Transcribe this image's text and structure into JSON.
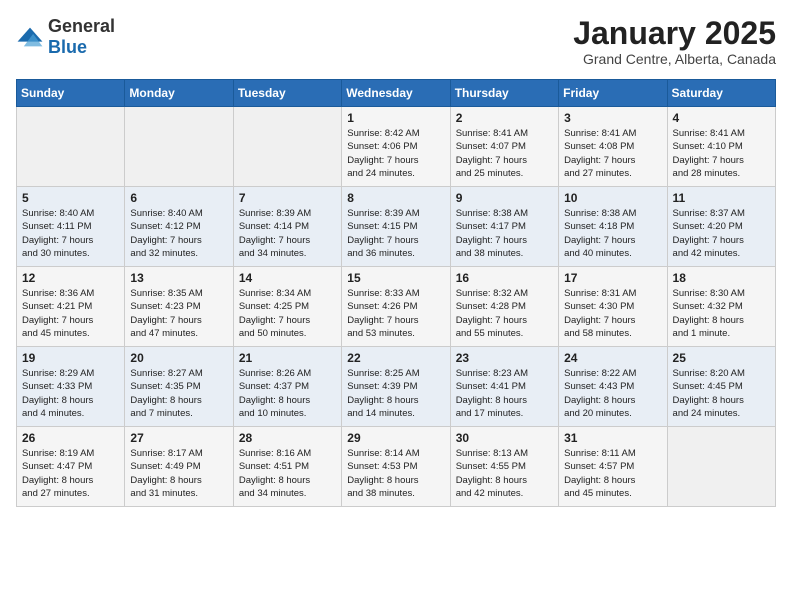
{
  "logo": {
    "general": "General",
    "blue": "Blue"
  },
  "title": {
    "month_year": "January 2025",
    "location": "Grand Centre, Alberta, Canada"
  },
  "days_of_week": [
    "Sunday",
    "Monday",
    "Tuesday",
    "Wednesday",
    "Thursday",
    "Friday",
    "Saturday"
  ],
  "weeks": [
    [
      {
        "day": "",
        "content": ""
      },
      {
        "day": "",
        "content": ""
      },
      {
        "day": "",
        "content": ""
      },
      {
        "day": "1",
        "content": "Sunrise: 8:42 AM\nSunset: 4:06 PM\nDaylight: 7 hours\nand 24 minutes."
      },
      {
        "day": "2",
        "content": "Sunrise: 8:41 AM\nSunset: 4:07 PM\nDaylight: 7 hours\nand 25 minutes."
      },
      {
        "day": "3",
        "content": "Sunrise: 8:41 AM\nSunset: 4:08 PM\nDaylight: 7 hours\nand 27 minutes."
      },
      {
        "day": "4",
        "content": "Sunrise: 8:41 AM\nSunset: 4:10 PM\nDaylight: 7 hours\nand 28 minutes."
      }
    ],
    [
      {
        "day": "5",
        "content": "Sunrise: 8:40 AM\nSunset: 4:11 PM\nDaylight: 7 hours\nand 30 minutes."
      },
      {
        "day": "6",
        "content": "Sunrise: 8:40 AM\nSunset: 4:12 PM\nDaylight: 7 hours\nand 32 minutes."
      },
      {
        "day": "7",
        "content": "Sunrise: 8:39 AM\nSunset: 4:14 PM\nDaylight: 7 hours\nand 34 minutes."
      },
      {
        "day": "8",
        "content": "Sunrise: 8:39 AM\nSunset: 4:15 PM\nDaylight: 7 hours\nand 36 minutes."
      },
      {
        "day": "9",
        "content": "Sunrise: 8:38 AM\nSunset: 4:17 PM\nDaylight: 7 hours\nand 38 minutes."
      },
      {
        "day": "10",
        "content": "Sunrise: 8:38 AM\nSunset: 4:18 PM\nDaylight: 7 hours\nand 40 minutes."
      },
      {
        "day": "11",
        "content": "Sunrise: 8:37 AM\nSunset: 4:20 PM\nDaylight: 7 hours\nand 42 minutes."
      }
    ],
    [
      {
        "day": "12",
        "content": "Sunrise: 8:36 AM\nSunset: 4:21 PM\nDaylight: 7 hours\nand 45 minutes."
      },
      {
        "day": "13",
        "content": "Sunrise: 8:35 AM\nSunset: 4:23 PM\nDaylight: 7 hours\nand 47 minutes."
      },
      {
        "day": "14",
        "content": "Sunrise: 8:34 AM\nSunset: 4:25 PM\nDaylight: 7 hours\nand 50 minutes."
      },
      {
        "day": "15",
        "content": "Sunrise: 8:33 AM\nSunset: 4:26 PM\nDaylight: 7 hours\nand 53 minutes."
      },
      {
        "day": "16",
        "content": "Sunrise: 8:32 AM\nSunset: 4:28 PM\nDaylight: 7 hours\nand 55 minutes."
      },
      {
        "day": "17",
        "content": "Sunrise: 8:31 AM\nSunset: 4:30 PM\nDaylight: 7 hours\nand 58 minutes."
      },
      {
        "day": "18",
        "content": "Sunrise: 8:30 AM\nSunset: 4:32 PM\nDaylight: 8 hours\nand 1 minute."
      }
    ],
    [
      {
        "day": "19",
        "content": "Sunrise: 8:29 AM\nSunset: 4:33 PM\nDaylight: 8 hours\nand 4 minutes."
      },
      {
        "day": "20",
        "content": "Sunrise: 8:27 AM\nSunset: 4:35 PM\nDaylight: 8 hours\nand 7 minutes."
      },
      {
        "day": "21",
        "content": "Sunrise: 8:26 AM\nSunset: 4:37 PM\nDaylight: 8 hours\nand 10 minutes."
      },
      {
        "day": "22",
        "content": "Sunrise: 8:25 AM\nSunset: 4:39 PM\nDaylight: 8 hours\nand 14 minutes."
      },
      {
        "day": "23",
        "content": "Sunrise: 8:23 AM\nSunset: 4:41 PM\nDaylight: 8 hours\nand 17 minutes."
      },
      {
        "day": "24",
        "content": "Sunrise: 8:22 AM\nSunset: 4:43 PM\nDaylight: 8 hours\nand 20 minutes."
      },
      {
        "day": "25",
        "content": "Sunrise: 8:20 AM\nSunset: 4:45 PM\nDaylight: 8 hours\nand 24 minutes."
      }
    ],
    [
      {
        "day": "26",
        "content": "Sunrise: 8:19 AM\nSunset: 4:47 PM\nDaylight: 8 hours\nand 27 minutes."
      },
      {
        "day": "27",
        "content": "Sunrise: 8:17 AM\nSunset: 4:49 PM\nDaylight: 8 hours\nand 31 minutes."
      },
      {
        "day": "28",
        "content": "Sunrise: 8:16 AM\nSunset: 4:51 PM\nDaylight: 8 hours\nand 34 minutes."
      },
      {
        "day": "29",
        "content": "Sunrise: 8:14 AM\nSunset: 4:53 PM\nDaylight: 8 hours\nand 38 minutes."
      },
      {
        "day": "30",
        "content": "Sunrise: 8:13 AM\nSunset: 4:55 PM\nDaylight: 8 hours\nand 42 minutes."
      },
      {
        "day": "31",
        "content": "Sunrise: 8:11 AM\nSunset: 4:57 PM\nDaylight: 8 hours\nand 45 minutes."
      },
      {
        "day": "",
        "content": ""
      }
    ]
  ]
}
